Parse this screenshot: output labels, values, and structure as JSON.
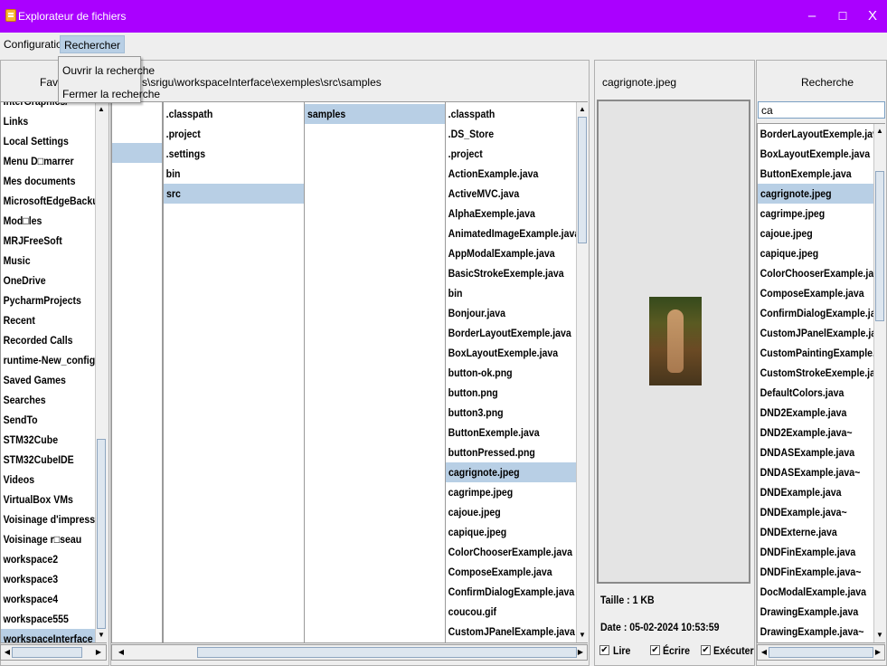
{
  "window": {
    "title": "Explorateur de fichiers",
    "controls": {
      "minimize": "–",
      "maximize": "☐",
      "close": "X"
    }
  },
  "menubar": {
    "items": [
      "Configuration",
      "Rechercher"
    ],
    "dropdown": [
      "Ouvrir la recherche",
      "Fermer la recherche"
    ]
  },
  "favorites": {
    "header": "Favo",
    "items": [
      "InterGraphics/",
      "Links",
      "Local Settings",
      "Menu D□marrer",
      "Mes documents",
      "MicrosoftEdgeBackups",
      "Mod□les",
      "MRJFreeSoft",
      "Music",
      "OneDrive",
      "PycharmProjects",
      "Recent",
      "Recorded Calls",
      "runtime-New_configuratio",
      "Saved Games",
      "Searches",
      "SendTo",
      "STM32Cube",
      "STM32CubeIDE",
      "Videos",
      "VirtualBox VMs",
      "Voisinage d'impression",
      "Voisinage r□seau",
      "workspace2",
      "workspace3",
      "workspace4",
      "workspace555",
      "workspaceInterface"
    ],
    "selected": "workspaceInterface"
  },
  "browser": {
    "path": "s\\srigu\\workspaceInterface\\exemples\\src\\samples",
    "col2": [
      ".classpath",
      ".project",
      ".settings",
      "bin",
      "src"
    ],
    "col2_selected": "src",
    "col3": [
      "samples"
    ],
    "col3_selected": "samples",
    "col4": [
      ".classpath",
      ".DS_Store",
      ".project",
      "ActionExample.java",
      "ActiveMVC.java",
      "AlphaExemple.java",
      "AnimatedImageExample.java",
      "AppModalExample.java",
      "BasicStrokeExemple.java",
      "bin",
      "Bonjour.java",
      "BorderLayoutExemple.java",
      "BoxLayoutExemple.java",
      "button-ok.png",
      "button.png",
      "button3.png",
      "ButtonExemple.java",
      "buttonPressed.png",
      "cagrignote.jpeg",
      "cagrimpe.jpeg",
      "cajoue.jpeg",
      "capique.jpeg",
      "ColorChooserExample.java",
      "ComposeExample.java",
      "ConfirmDialogExample.java",
      "coucou.gif",
      "CustomJPanelExample.java"
    ],
    "col4_selected": "cagrignote.jpeg"
  },
  "preview": {
    "filename": "cagrignote.jpeg",
    "size": "Taille : 1 KB",
    "date": "Date : 05-02-2024 10:53:59",
    "perms": [
      {
        "label": "Lire",
        "checked": "✔"
      },
      {
        "label": "Écrire",
        "checked": "✔"
      },
      {
        "label": "Exécuter",
        "checked": "✔"
      }
    ]
  },
  "search": {
    "header": "Recherche",
    "query": "ca",
    "results": [
      "BorderLayoutExemple.java",
      "BoxLayoutExemple.java",
      "ButtonExemple.java",
      "cagrignote.jpeg",
      "cagrimpe.jpeg",
      "cajoue.jpeg",
      "capique.jpeg",
      "ColorChooserExample.java",
      "ComposeExample.java",
      "ConfirmDialogExample.java",
      "CustomJPanelExample.java",
      "CustomPaintingExample.java",
      "CustomStrokeExemple.java",
      "DefaultColors.java",
      "DND2Example.java",
      "DND2Example.java~",
      "DNDASExample.java",
      "DNDASExample.java~",
      "DNDExample.java",
      "DNDExample.java~",
      "DNDExterne.java",
      "DNDFinExample.java",
      "DNDFinExample.java~",
      "DocModalExample.java",
      "DrawingExample.java",
      "DrawingExample.java~"
    ],
    "selected": "cagrignote.jpeg"
  },
  "colors": {
    "titlebar": "#aa00ff",
    "selection": "#b8cfe5"
  }
}
